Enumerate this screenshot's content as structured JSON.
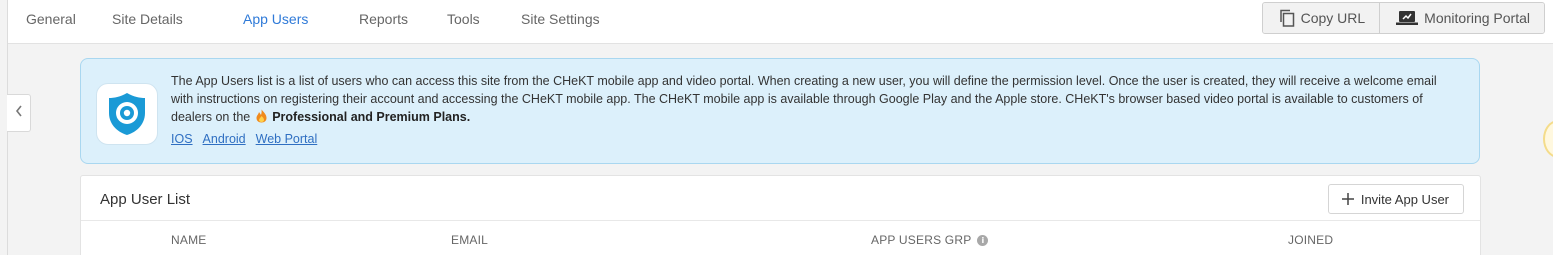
{
  "nav": {
    "tabs": [
      {
        "label": "General",
        "active": false
      },
      {
        "label": "Site Details",
        "active": false
      },
      {
        "label": "App Users",
        "active": true
      },
      {
        "label": "Reports",
        "active": false
      },
      {
        "label": "Tools",
        "active": false
      },
      {
        "label": "Site Settings",
        "active": false
      }
    ],
    "copy_url_label": "Copy URL",
    "monitoring_portal_label": "Monitoring Portal"
  },
  "info": {
    "text_main": "The App Users list is a list of users who can access this site from the CHeKT mobile app and video portal. When creating a new user, you will define the permission level. Once the user is created, they will receive a welcome email with instructions on registering their account and accessing the CHeKT mobile app. The CHeKT mobile app is available through Google Play and the Apple store. CHeKT's browser based video portal is available to customers of dealers on the",
    "plans_label": "Professional and Premium Plans.",
    "links": [
      "IOS",
      "Android",
      "Web Portal"
    ]
  },
  "list": {
    "title": "App User List",
    "invite_label": "Invite App User",
    "columns": {
      "name": "NAME",
      "email": "EMAIL",
      "group": "APP USERS GRP",
      "joined": "JOINED"
    }
  },
  "colors": {
    "accent": "#2f7ad8",
    "info_bg": "#dcf0fb",
    "info_border": "#a9d7f0",
    "shield": "#1a9ad6",
    "flame": "#f08a1c"
  },
  "icons": {
    "copy": "copy-icon",
    "monitor": "monitor-icon",
    "chevron": "chevron-left-icon",
    "app": "chekt-shield-icon",
    "flame": "flame-icon",
    "plus": "plus-icon",
    "info": "info-icon"
  }
}
